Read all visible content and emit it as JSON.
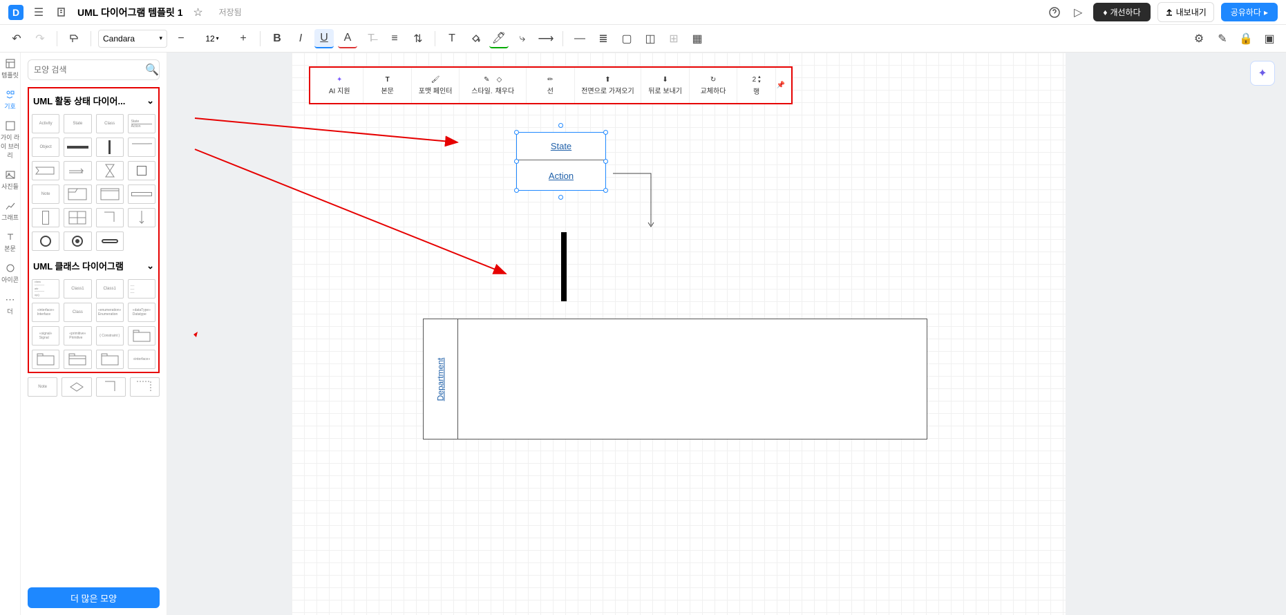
{
  "header": {
    "title": "UML 다이어그램 템플릿 1",
    "saved": "저장됨",
    "improve_btn": "개선하다",
    "export_btn": "내보내기",
    "share_btn": "공유하다"
  },
  "toolbar": {
    "font_name": "Candara",
    "font_size": "12"
  },
  "rail": {
    "template": "템플릿",
    "basic": "기호",
    "library": "가이 라이 브러리",
    "photos": "사진들",
    "chart": "그래프",
    "text": "본문",
    "icons": "아이콘",
    "more": "더"
  },
  "shapes": {
    "search_placeholder": "모양 검색",
    "section1": "UML 활동 상태 다이어...",
    "section2": "UML 클래스 다이어그램",
    "more_shapes": "더 많은 모양"
  },
  "float_toolbar": {
    "ai": "AI 지원",
    "body": "본문",
    "format": "포맷 페인터",
    "style": "스타일.",
    "fill": "채우다",
    "line": "선",
    "front": "전면으로 가져오기",
    "back": "뒤로 보내기",
    "replace": "교체하다",
    "count": "2",
    "row": "행"
  },
  "canvas": {
    "state": "State",
    "action": "Action",
    "department": "Department"
  }
}
